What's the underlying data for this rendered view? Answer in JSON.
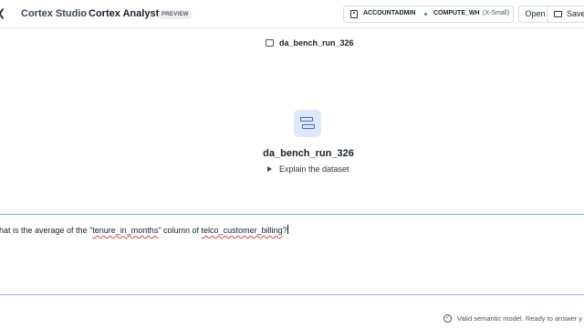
{
  "header": {
    "back_glyph": "❮",
    "studio": "Cortex Studio",
    "title": "Cortex Analyst",
    "badge": "PREVIEW",
    "role": "ACCOUNTADMIN",
    "warehouse": "COMPUTE_WH",
    "warehouse_size": "(X-Small)",
    "open_label": "Open",
    "save_label": "Save"
  },
  "model_reference": "da_bench_run_326",
  "center": {
    "title": "da_bench_run_326",
    "explain_label": "Explain the dataset"
  },
  "question": {
    "prefix": "hat is the average of the \"",
    "term1": "tenure_in_months",
    "middle": "\" column of ",
    "term2": "telco_customer_billing",
    "suffix": "?"
  },
  "status": {
    "check_glyph": "✓",
    "text": "Valid semantic model. Ready to answer y"
  },
  "colors": {
    "accent": "#2f6fdc",
    "accent_bg": "#dfe9fb",
    "status_green": "#2a9d5c"
  }
}
